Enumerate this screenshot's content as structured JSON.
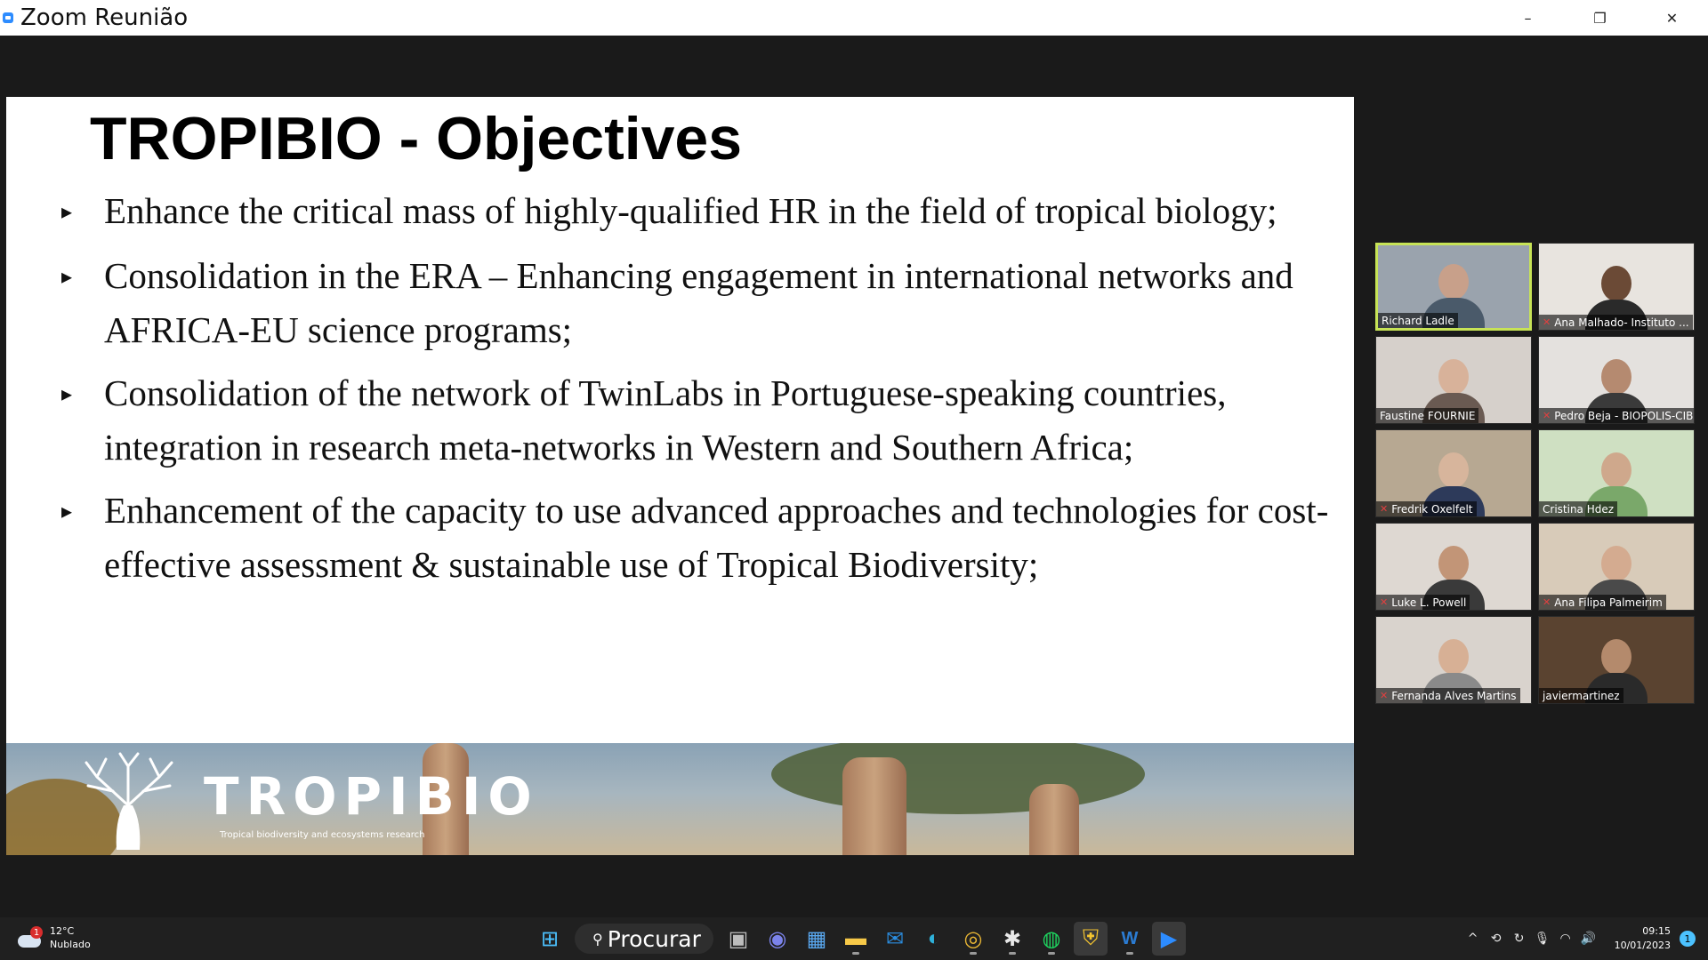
{
  "window": {
    "title": "Zoom Reunião",
    "minimize_glyph": "–",
    "restore_glyph": "❐",
    "close_glyph": "✕"
  },
  "slide": {
    "title": "TROPIBIO - Objectives",
    "bullet_marker": "▸",
    "bullets": [
      "Enhance the critical mass of highly-qualified HR in the field of tropical biology;",
      "Consolidation in the ERA – Enhancing engagement in international networks and AFRICA-EU science programs;",
      "Consolidation of the network of TwinLabs in Portuguese-speaking countries, integration in research meta-networks in Western and Southern Africa;",
      "Enhancement of the capacity to use advanced approaches and technologies for cost-effective assessment & sustainable use of Tropical Biodiversity;"
    ],
    "banner": {
      "logo_text": "TROPIBIO",
      "tagline": "Tropical biodiversity and ecosystems research"
    }
  },
  "participants": [
    {
      "name": "Richard Ladle",
      "muted": false,
      "speaking": true,
      "bg": "#9aa3ad",
      "skin": "#c8a08a",
      "shirt": "#4a5a6a"
    },
    {
      "name": "Ana Malhado- Instituto ...",
      "muted": true,
      "speaking": false,
      "bg": "#e8e4df",
      "skin": "#6b4a36",
      "shirt": "#2a2a2a"
    },
    {
      "name": "Faustine FOURNIE",
      "muted": false,
      "speaking": false,
      "bg": "#d6d0cb",
      "skin": "#d8b29a",
      "shirt": "#6a5a52"
    },
    {
      "name": "Pedro Beja - BIOPOLIS-CIBIO",
      "muted": true,
      "speaking": false,
      "bg": "#e4e1de",
      "skin": "#b58a70",
      "shirt": "#3a3a3a"
    },
    {
      "name": "Fredrik Oxelfelt",
      "muted": true,
      "speaking": false,
      "bg": "#b7a892",
      "skin": "#d7b59c",
      "shirt": "#2d3a5a"
    },
    {
      "name": "Cristina Hdez",
      "muted": false,
      "speaking": false,
      "bg": "#cfe0c2",
      "skin": "#cfa88c",
      "shirt": "#7aa86a"
    },
    {
      "name": "Luke L. Powell",
      "muted": true,
      "speaking": false,
      "bg": "#ded8d2",
      "skin": "#c29577",
      "shirt": "#3a3a3a"
    },
    {
      "name": "Ana Filipa Palmeirim",
      "muted": true,
      "speaking": false,
      "bg": "#d8cbb9",
      "skin": "#d4ab90",
      "shirt": "#4a4a4a"
    },
    {
      "name": "Fernanda Alves Martins",
      "muted": true,
      "speaking": false,
      "bg": "#d9d3cd",
      "skin": "#d7b095",
      "shirt": "#8a8a8a"
    },
    {
      "name": "javiermartinez",
      "muted": false,
      "speaking": false,
      "bg": "#5a4330",
      "skin": "#b48a6c",
      "shirt": "#2a2a2a"
    }
  ],
  "taskbar": {
    "weather": {
      "temp": "12°C",
      "condition": "Nublado",
      "badge": "1"
    },
    "search_label": "Procurar",
    "search_glyph": "⚲",
    "apps": [
      {
        "name": "start-icon",
        "glyph": "⊞",
        "color": "#4cc2ff",
        "state": ""
      },
      {
        "name": "task-view-icon",
        "glyph": "▣",
        "color": "#bdbdbd",
        "state": ""
      },
      {
        "name": "teams-chat-icon",
        "glyph": "◉",
        "color": "#7b83eb",
        "state": ""
      },
      {
        "name": "store-icon",
        "glyph": "▦",
        "color": "#59a8f0",
        "state": ""
      },
      {
        "name": "file-explorer-icon",
        "glyph": "▬",
        "color": "#f7c948",
        "state": "running"
      },
      {
        "name": "mail-icon",
        "glyph": "✉",
        "color": "#2b8de0",
        "state": ""
      },
      {
        "name": "edge-icon",
        "glyph": "◐",
        "color": "#2fb1d9",
        "state": ""
      },
      {
        "name": "chrome-icon",
        "glyph": "◎",
        "color": "#e9b634",
        "state": "running"
      },
      {
        "name": "slack-icon",
        "glyph": "✱",
        "color": "#e8e8e8",
        "state": "running"
      },
      {
        "name": "spotify-icon",
        "glyph": "◍",
        "color": "#1ed760",
        "state": "running"
      },
      {
        "name": "security-shield-icon",
        "glyph": "⛨",
        "color": "#f4c430",
        "state": "active"
      },
      {
        "name": "word-icon",
        "glyph": "W",
        "color": "#2b7cd3",
        "state": "running"
      },
      {
        "name": "zoom-icon",
        "glyph": "▶",
        "color": "#2d8cff",
        "state": "active"
      }
    ],
    "tray_icons": [
      {
        "name": "chevron-up-icon",
        "glyph": "^"
      },
      {
        "name": "sync-alert-icon",
        "glyph": "⟲"
      },
      {
        "name": "refresh-icon",
        "glyph": "↻"
      },
      {
        "name": "microphone-icon",
        "glyph": "🎙"
      },
      {
        "name": "wifi-icon",
        "glyph": "◠"
      },
      {
        "name": "speaker-icon",
        "glyph": "🔊"
      }
    ],
    "clock": {
      "time": "09:15",
      "date": "10/01/2023"
    },
    "notification_count": "1"
  }
}
